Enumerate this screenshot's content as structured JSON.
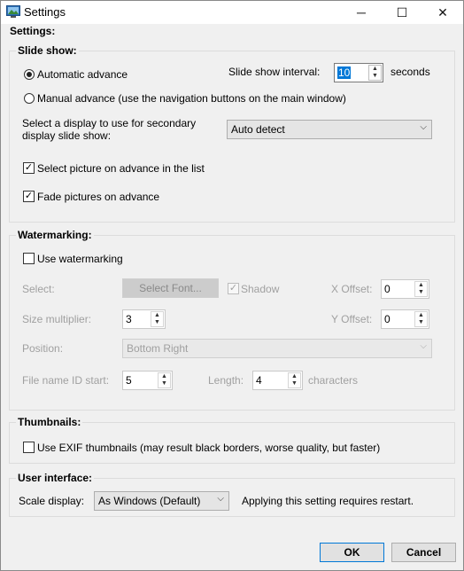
{
  "window": {
    "title": "Settings",
    "minimize": "─",
    "maximize": "☐",
    "close": "✕"
  },
  "settings_label": "Settings:",
  "slideshow": {
    "title": "Slide show:",
    "auto_advance": "Automatic advance",
    "manual_advance": "Manual advance (use the navigation buttons on the main window)",
    "interval_label": "Slide show interval:",
    "interval_value": "10",
    "interval_unit": "seconds",
    "display_label": "Select a display to use for secondary display slide show:",
    "display_value": "Auto detect",
    "select_in_list": "Select picture on advance in the list",
    "fade": "Fade pictures on advance"
  },
  "watermark": {
    "title": "Watermarking:",
    "use": "Use watermarking",
    "select_label": "Select:",
    "select_font": "Select Font...",
    "shadow": "Shadow",
    "x_offset_label": "X Offset:",
    "x_offset_value": "0",
    "size_label": "Size multiplier:",
    "size_value": "3",
    "y_offset_label": "Y Offset:",
    "y_offset_value": "0",
    "position_label": "Position:",
    "position_value": "Bottom Right",
    "fileid_label": "File name ID start:",
    "fileid_value": "5",
    "length_label": "Length:",
    "length_value": "4",
    "length_unit": "characters"
  },
  "thumbnails": {
    "title": "Thumbnails:",
    "exif": "Use EXIF thumbnails (may result black borders, worse quality, but faster)"
  },
  "ui": {
    "title": "User interface:",
    "scale_label": "Scale display:",
    "scale_value": "As Windows (Default)",
    "restart_note": "Applying this setting requires restart."
  },
  "buttons": {
    "ok": "OK",
    "cancel": "Cancel"
  }
}
